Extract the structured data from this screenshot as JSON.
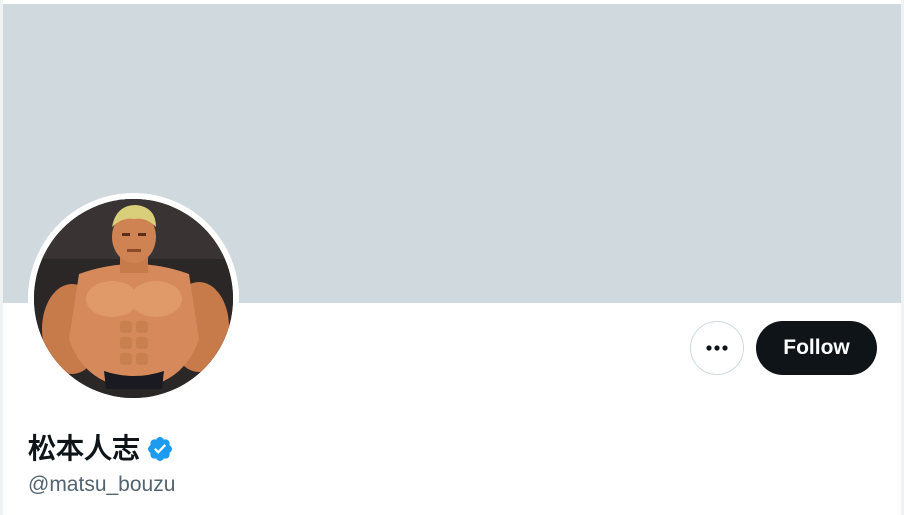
{
  "profile": {
    "display_name": "松本人志",
    "handle": "@matsu_bouzu",
    "verified": true
  },
  "actions": {
    "follow_label": "Follow",
    "more_icon": "more-horizontal-icon"
  },
  "colors": {
    "banner": "#cfd9de",
    "follow_bg": "#0f1419",
    "follow_text": "#ffffff",
    "verified_badge": "#1d9bf0",
    "handle_text": "#536471",
    "name_text": "#0f1419"
  }
}
